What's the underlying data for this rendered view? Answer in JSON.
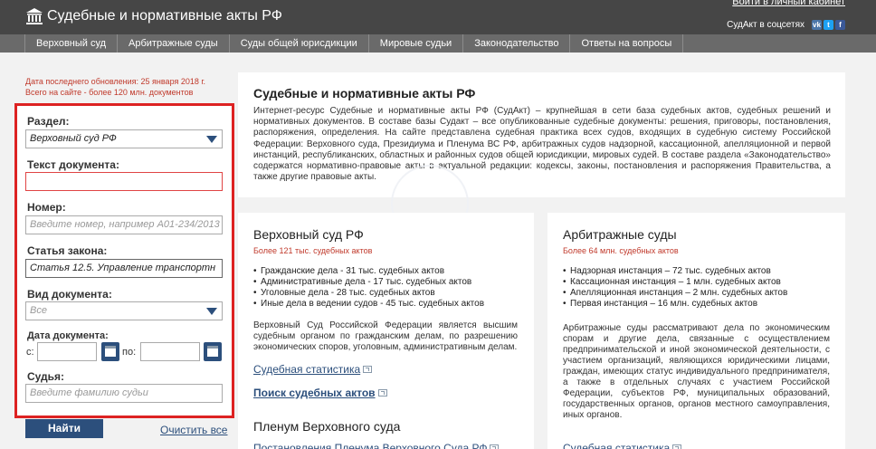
{
  "header": {
    "logo_text": "Судебные и нормативные акты РФ",
    "login_link": "Войти в личный кабинет",
    "social_label": "СудАкт в соцсетях",
    "social_icons": [
      "vk-icon",
      "twitter-icon",
      "facebook-icon"
    ]
  },
  "nav": {
    "items": [
      "Верховный суд",
      "Арбитражные суды",
      "Суды общей юрисдикции",
      "Мировые судьи",
      "Законодательство",
      "Ответы на вопросы"
    ]
  },
  "update_info": {
    "line1": "Дата последнего обновления: 25 января 2018 г.",
    "line2": "Всего на сайте - более 120 млн. документов"
  },
  "search": {
    "section_label": "Раздел:",
    "section_value": "Верховный суд РФ",
    "text_label": "Текст документа:",
    "text_value": "",
    "number_label": "Номер:",
    "number_placeholder": "Введите номер, например А01-234/2013",
    "law_label": "Статья закона:",
    "law_value": "Статья 12.5. Управление транспортн",
    "doctype_label": "Вид документа:",
    "doctype_value": "Все",
    "date_label": "Дата документа:",
    "date_from_label": "с:",
    "date_to_label": "по:",
    "judge_label": "Судья:",
    "judge_placeholder": "Введите фамилию судьи",
    "find_button": "Найти",
    "clear_link": "Очистить все"
  },
  "intro": {
    "title": "Судебные и нормативные акты РФ",
    "text": "Интернет-ресурс Судебные и нормативные акты РФ (СудАкт) – крупнейшая в сети база судебных актов, судебных решений и нормативных документов. В составе базы Судакт – все опубликованные судебные документы: решения, приговоры, постановления, распоряжения, определения. На сайте представлена судебная практика всех судов, входящих в судебную систему Российской Федерации: Верховного суда, Президиума и Пленума ВС РФ, арбитражных судов надзорной, кассационной, апелляционной и первой инстанций, республиканских, областных и районных судов общей юрисдикции, мировых судей. В составе раздела «Законодательство» содержатся нормативно-правовые акты в актуальной редакции: кодексы, законы, постановления и распоряжения Правительства, а также другие правовые акты."
  },
  "supreme": {
    "title": "Верховный суд РФ",
    "subtitle": "Более 121 тыс. судебных актов",
    "items": [
      "Гражданские дела - 31 тыс. судебных актов",
      "Административные дела - 17 тыс. судебных актов",
      "Уголовные дела - 28 тыс. судебных актов",
      "Иные дела в ведении судов - 45 тыс. судебных актов"
    ],
    "description": "Верховный Суд Российской Федерации является высшим судебным органом по гражданским делам, по разрешению экономических споров, уголовным, административным делам.",
    "stats_link": "Судебная статистика",
    "search_link": "Поиск судебных актов",
    "plenum_title": "Пленум Верховного суда",
    "plenum_link": "Постановления Пленума Верховного Суда РФ"
  },
  "arbitration": {
    "title": "Арбитражные суды",
    "subtitle": "Более 64 млн. судебных актов",
    "items": [
      "Надзорная инстанция – 72 тыс. судебных актов",
      "Кассационная инстанция – 1 млн. судебных актов",
      "Апелляционная инстанция – 2 млн. судебных актов",
      "Первая инстанция – 16 млн. судебных актов"
    ],
    "description": "Арбитражные суды рассматривают дела по экономическим спорам и другие дела, связанные с осуществлением предпринимательской и иной экономической деятельности, с участием организаций, являющихся юридическими лицами, граждан, имеющих статус индивидуального предпринимателя, а также в отдельных случаях с участием Российской Федерации, субъектов РФ, муниципальных образований, государственных органов, органов местного самоуправления, иных органов.",
    "stats_link": "Судебная статистика"
  }
}
